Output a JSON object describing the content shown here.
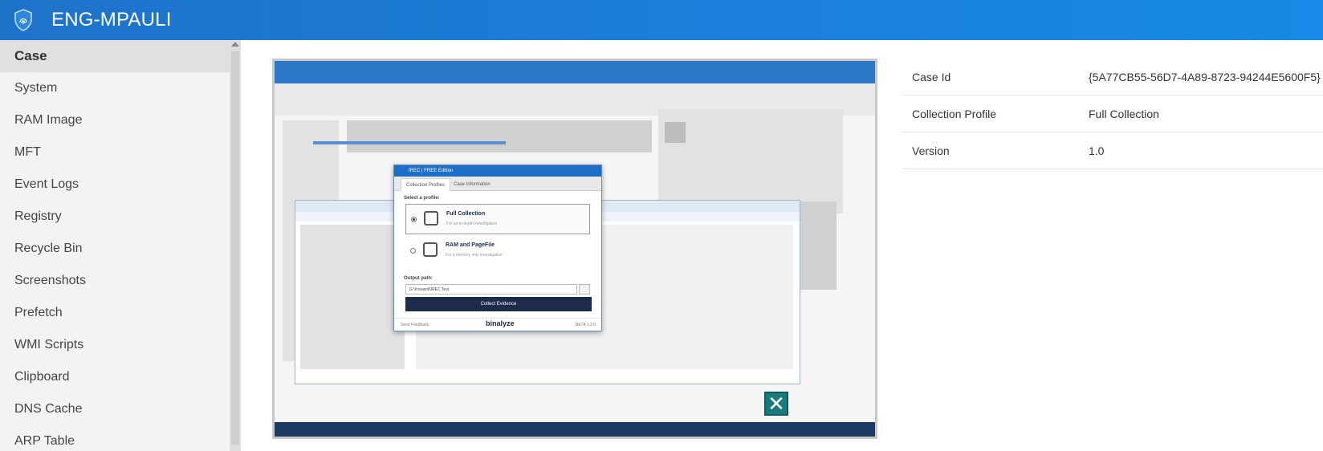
{
  "header": {
    "title": "ENG-MPAULI",
    "logo_icon": "fingerprint-shield-icon"
  },
  "sidebar": {
    "items": [
      {
        "label": "Case",
        "active": true
      },
      {
        "label": "System"
      },
      {
        "label": "RAM Image"
      },
      {
        "label": "MFT"
      },
      {
        "label": "Event Logs"
      },
      {
        "label": "Registry"
      },
      {
        "label": "Recycle Bin"
      },
      {
        "label": "Screenshots"
      },
      {
        "label": "Prefetch"
      },
      {
        "label": "WMI Scripts"
      },
      {
        "label": "Clipboard"
      },
      {
        "label": "DNS Cache"
      },
      {
        "label": "ARP Table"
      }
    ]
  },
  "screenshot": {
    "dialog": {
      "title": "IREC | FREE Edition",
      "tabs": [
        "Collection Profiles",
        "Case Information"
      ],
      "select_label": "Select a profile:",
      "options": [
        {
          "title": "Full Collection",
          "desc": "For an in-depth investigation"
        },
        {
          "title": "RAM and PageFile",
          "desc": "For a memory only investigation"
        }
      ],
      "output_label": "Output path:",
      "output_path": "G:\\Irovasoli\\IREC Test",
      "collect_button": "Collect Evidence",
      "send_feedback": "Send Feedback",
      "brand": "binalyze",
      "version": "BETA 1.2.0"
    }
  },
  "case_info": [
    {
      "key": "Case Id",
      "value": "{5A77CB55-56D7-4A89-8723-94244E5600F5}"
    },
    {
      "key": "Collection Profile",
      "value": "Full Collection"
    },
    {
      "key": "Version",
      "value": "1.0"
    }
  ],
  "colors": {
    "header": "#1a80dc",
    "sidebar": "#f3f3f3",
    "active_item": "#e0e0e0"
  }
}
